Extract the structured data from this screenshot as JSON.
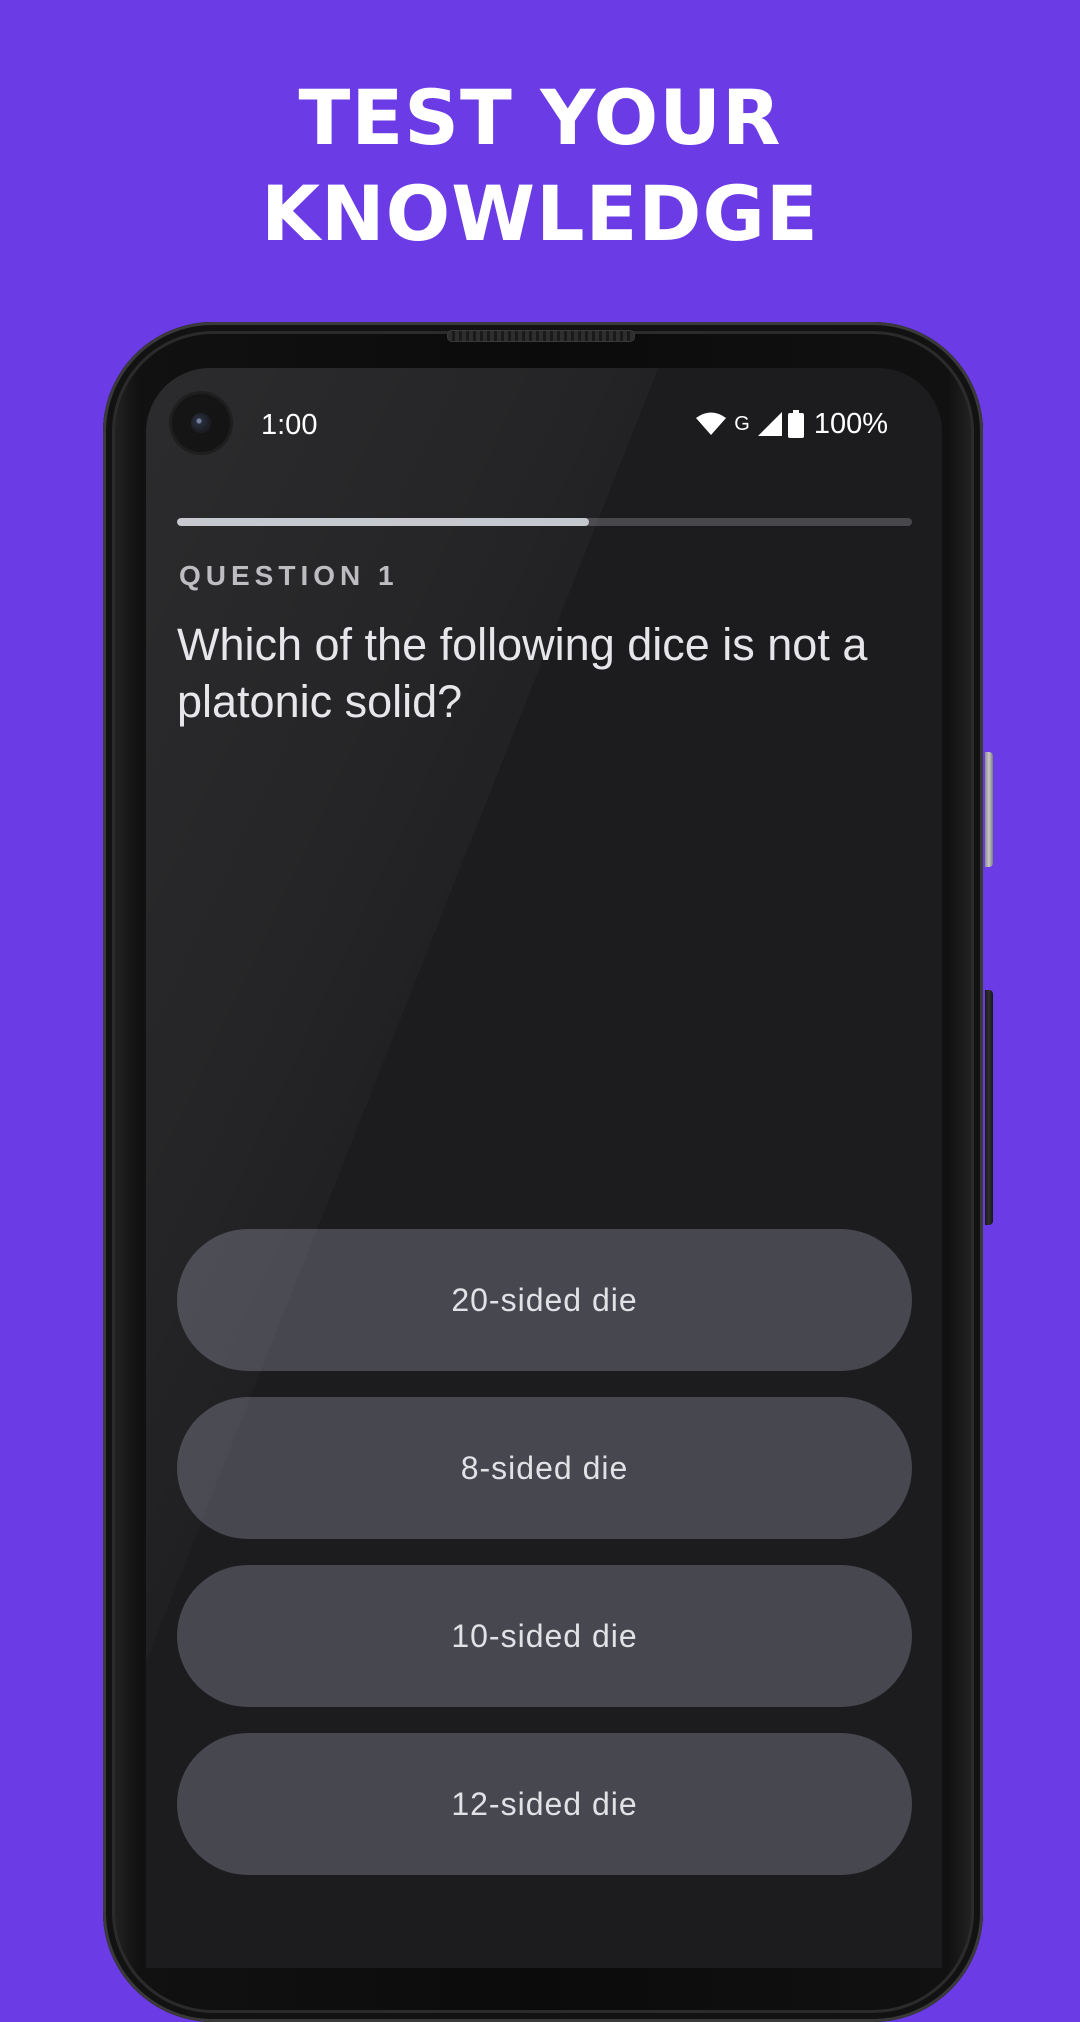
{
  "headline": {
    "line1": "TEST YOUR",
    "line2": "KNOWLEDGE"
  },
  "status_bar": {
    "time": "1:00",
    "network_label": "G",
    "battery": "100%",
    "icons": [
      "wifi-icon",
      "cell-signal-icon",
      "battery-icon"
    ]
  },
  "quiz": {
    "progress": 0.56,
    "question_label": "QUESTION 1",
    "question_text": "Which of the following dice is not a platonic solid?",
    "answers": [
      {
        "label": "20-sided die"
      },
      {
        "label": "8-sided die"
      },
      {
        "label": "10-sided die"
      },
      {
        "label": "12-sided die"
      }
    ]
  },
  "colors": {
    "background": "#6b3be6",
    "screen": "#1c1c1e",
    "answer_button": "#47474f",
    "progress_fill": "#c3c6cc",
    "progress_track": "#48484c"
  }
}
